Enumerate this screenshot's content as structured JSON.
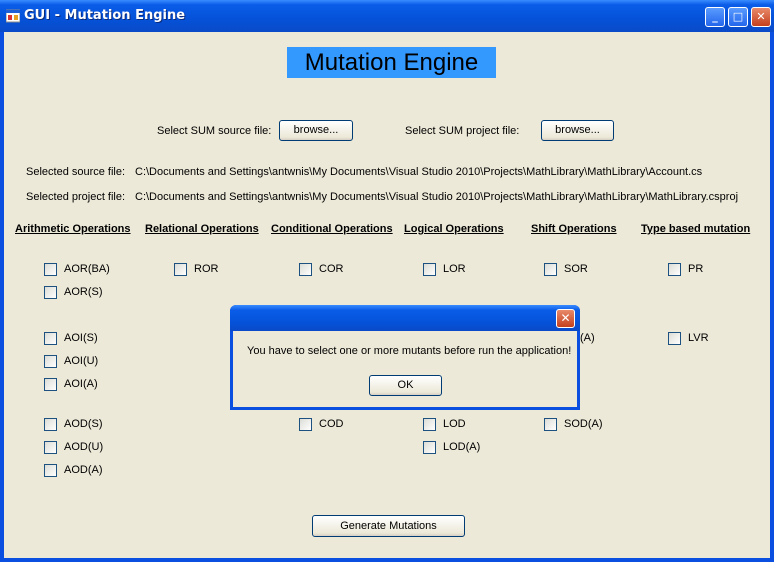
{
  "window": {
    "title": "GUI - Mutation Engine",
    "controls": {
      "minimize": "_",
      "maximize": "□",
      "close": "✕"
    }
  },
  "heading": "Mutation Engine",
  "files": {
    "source_label": "Select SUM source file:",
    "project_label": "Select SUM project file:",
    "browse_label": "browse...",
    "selected_source_label": "Selected source file:",
    "selected_source_value": "C:\\Documents and Settings\\antwnis\\My Documents\\Visual Studio 2010\\Projects\\MathLibrary\\MathLibrary\\Account.cs",
    "selected_project_label": "Selected project file:",
    "selected_project_value": "C:\\Documents and Settings\\antwnis\\My Documents\\Visual Studio 2010\\Projects\\MathLibrary\\MathLibrary\\MathLibrary.csproj"
  },
  "groups": {
    "arithmetic": "Arithmetic Operations",
    "relational": "Relational Operations",
    "conditional": "Conditional Operations",
    "logical": "Logical Operations",
    "shift": "Shift Operations",
    "type": "Type based mutation"
  },
  "checkboxes": {
    "aor_ba": "AOR(BA)",
    "aor_s": "AOR(S)",
    "aoi_s": "AOI(S)",
    "aoi_u": "AOI(U)",
    "aoi_a": "AOI(A)",
    "aod_s": "AOD(S)",
    "aod_u": "AOD(U)",
    "aod_a": "AOD(A)",
    "ror": "ROR",
    "cor": "COR",
    "cod": "COD",
    "lor": "LOR",
    "lod": "LOD",
    "lod_a": "LOD(A)",
    "sor": "SOR",
    "soi_a": "(A)",
    "sod_a": "SOD(A)",
    "pr": "PR",
    "lvr": "LVR"
  },
  "generate_label": "Generate Mutations",
  "dialog": {
    "message": "You have to select one or more mutants before run the application!",
    "ok_label": "OK",
    "close": "✕"
  },
  "colors": {
    "title_bar": "#0552d8",
    "client_bg": "#ece9d8",
    "heading_bg": "#3399ff"
  }
}
